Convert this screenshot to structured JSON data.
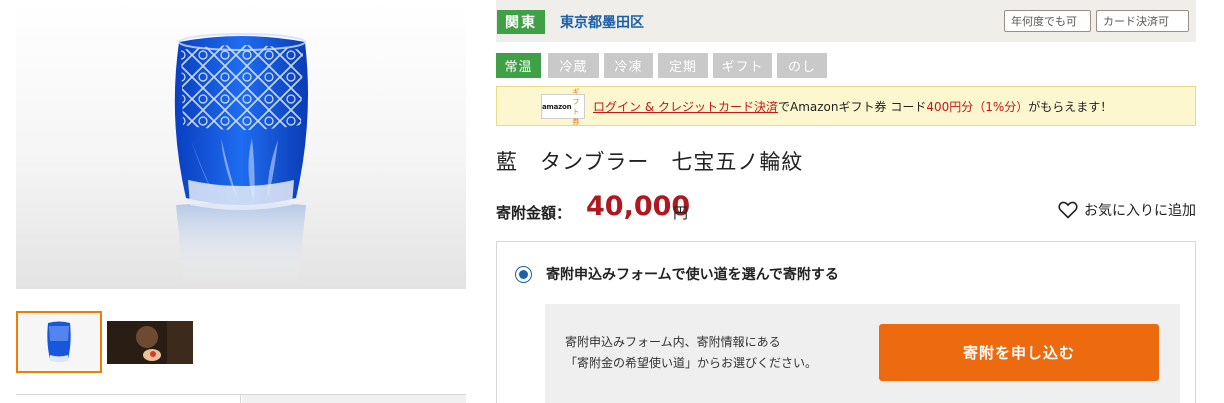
{
  "gallery": {
    "main_image_alt": "藍 タンブラー 七宝五ノ輪紋",
    "thumbnails": [
      "blue-cut-glass-tumbler",
      "person-holding-glass-photo"
    ]
  },
  "region": {
    "badge": "関東",
    "city": "東京都墨田区",
    "tags": [
      "年何度でも可",
      "カード決済可"
    ]
  },
  "temperature_tags": [
    {
      "label": "常温",
      "active": true
    },
    {
      "label": "冷蔵",
      "active": false
    },
    {
      "label": "冷凍",
      "active": false
    },
    {
      "label": "定期",
      "active": false
    },
    {
      "label": "ギフト",
      "active": false
    },
    {
      "label": "のし",
      "active": false
    }
  ],
  "amazon_banner": {
    "logo_text": "amazon",
    "logo_sub": "ギフト券",
    "link_text": "ログイン & クレジットカード決済",
    "text_1": "でAmazonギフト券 コード",
    "amount": "400円分（1%分）",
    "text_2": "がもらえます！"
  },
  "product": {
    "title": "藍　タンブラー　七宝五ノ輪紋",
    "price_label": "寄附金額：",
    "price_value": "40,000",
    "price_unit": "円",
    "favorite_label": "お気に入りに追加"
  },
  "donation": {
    "option_label": "寄附申込みフォームで使い道を選んで寄附する",
    "description_line_1": "寄附申込みフォーム内、寄附情報にある",
    "description_line_2": "「寄附金の希望使い道」からお選びください。",
    "button_label": "寄附を申し込む"
  },
  "colors": {
    "accent_green": "#3fa046",
    "price_red": "#b01820",
    "button_orange": "#ed6a0e",
    "link_blue": "#1d5fa8"
  }
}
